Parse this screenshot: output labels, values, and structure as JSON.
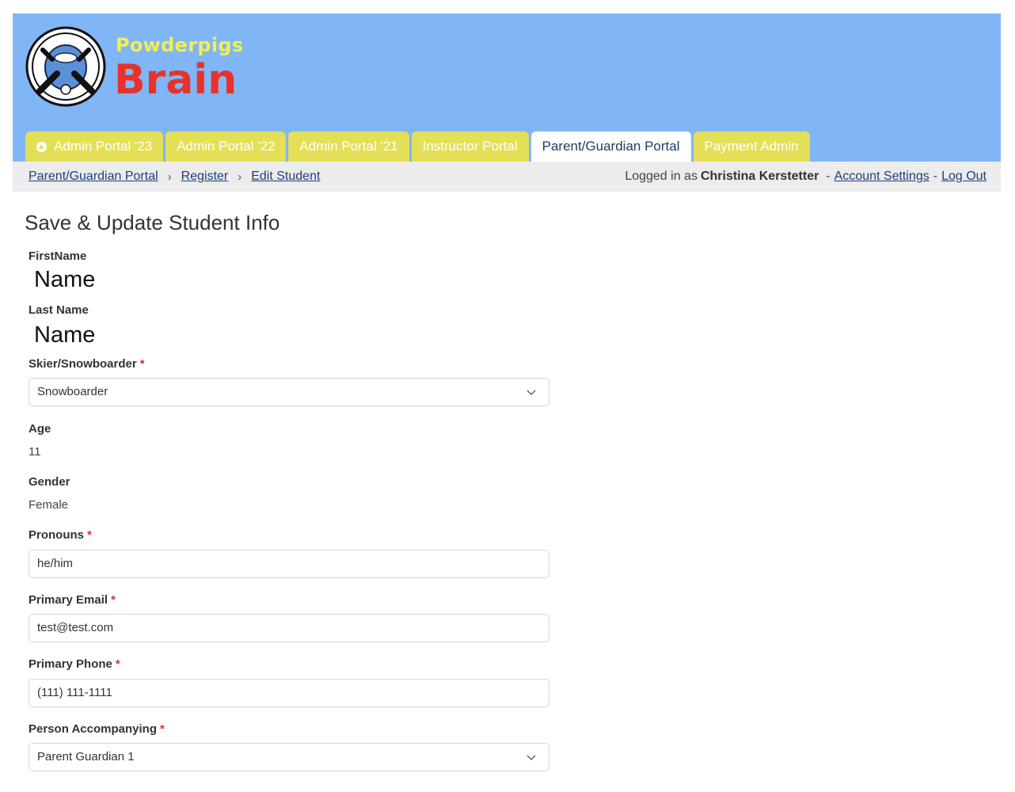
{
  "brand": {
    "top": "Powderpigs",
    "main": "Brain"
  },
  "tabs": [
    {
      "label": "Admin Portal '23",
      "icon": "up-arrow-circle-icon",
      "active": false
    },
    {
      "label": "Admin Portal '22",
      "active": false
    },
    {
      "label": "Admin Portal '21",
      "active": false
    },
    {
      "label": "Instructor Portal",
      "active": false
    },
    {
      "label": "Parent/Guardian Portal",
      "active": true
    },
    {
      "label": "Payment Admin",
      "active": false
    }
  ],
  "breadcrumb": [
    {
      "label": "Parent/Guardian Portal"
    },
    {
      "label": "Register"
    },
    {
      "label": "Edit Student"
    }
  ],
  "user": {
    "prefix": "Logged in as",
    "name": "Christina Kerstetter",
    "account_settings": "Account Settings",
    "logout": "Log Out"
  },
  "form": {
    "title": "Save & Update Student Info",
    "first_name_label": "FirstName",
    "first_name_value": "Name",
    "last_name_label": "Last Name",
    "last_name_value": "Name",
    "skier_label": "Skier/Snowboarder",
    "skier_value": "Snowboarder",
    "age_label": "Age",
    "age_value": "11",
    "gender_label": "Gender",
    "gender_value": "Female",
    "pronouns_label": "Pronouns",
    "pronouns_value": "he/him",
    "email_label": "Primary Email",
    "email_value": "test@test.com",
    "phone_label": "Primary Phone",
    "phone_value": "(111) 111-1111",
    "accompany_label": "Person Accompanying",
    "accompany_value": "Parent Guardian 1",
    "required_mark": "*"
  },
  "colors": {
    "header_bg": "#80b6f6",
    "tab_bg": "#e4df57",
    "brand_top": "#f2ef4f",
    "brand_main": "#e8322a",
    "required": "#d9302c"
  }
}
